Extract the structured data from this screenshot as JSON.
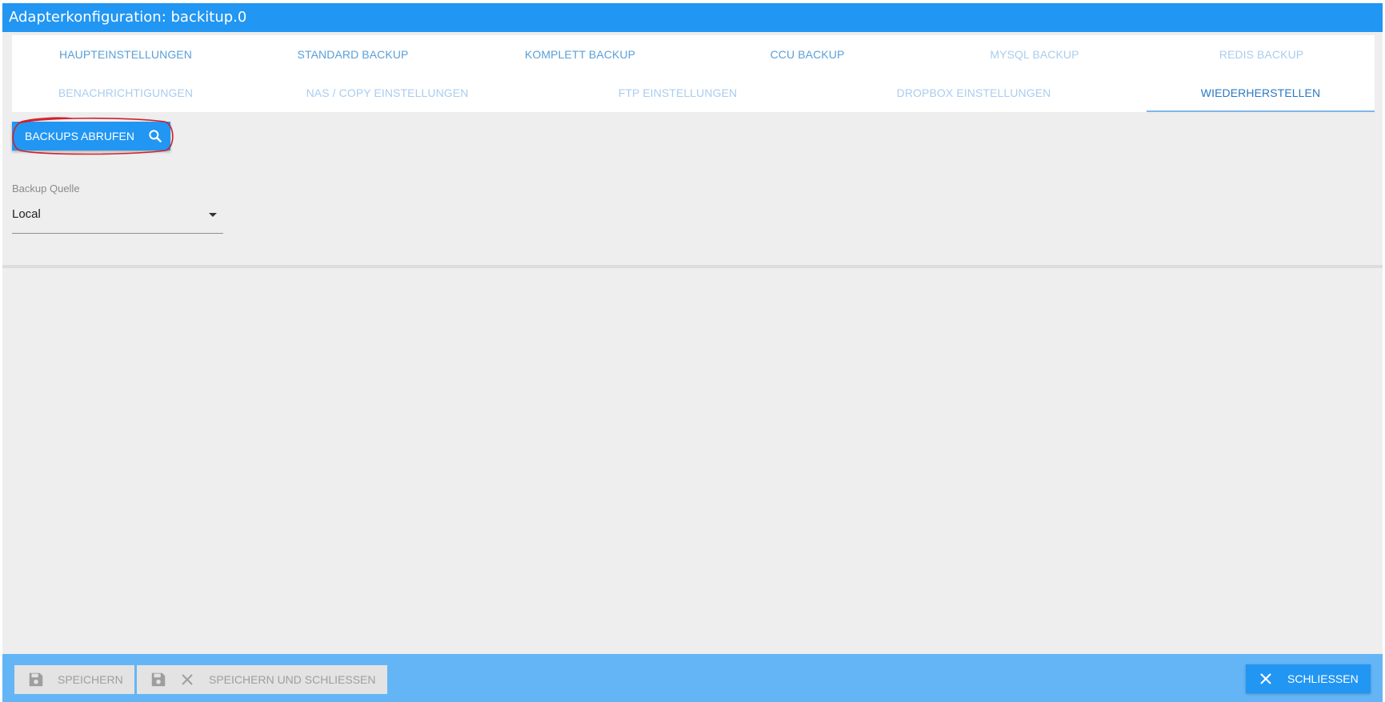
{
  "window": {
    "title": "Adapterkonfiguration: backitup.0"
  },
  "tabs": {
    "row1": [
      {
        "label": "HAUPTEINSTELLUNGEN",
        "state": "enabled"
      },
      {
        "label": "STANDARD BACKUP",
        "state": "enabled"
      },
      {
        "label": "KOMPLETT BACKUP",
        "state": "enabled"
      },
      {
        "label": "CCU BACKUP",
        "state": "enabled"
      },
      {
        "label": "MYSQL BACKUP",
        "state": "disabled"
      },
      {
        "label": "REDIS BACKUP",
        "state": "disabled"
      }
    ],
    "row2": [
      {
        "label": "BENACHRICHTIGUNGEN",
        "state": "disabled"
      },
      {
        "label": "NAS / COPY EINSTELLUNGEN",
        "state": "disabled"
      },
      {
        "label": "FTP EINSTELLUNGEN",
        "state": "disabled"
      },
      {
        "label": "DROPBOX EINSTELLUNGEN",
        "state": "disabled"
      },
      {
        "label": "WIEDERHERSTELLEN",
        "state": "active"
      }
    ]
  },
  "restore": {
    "fetch_button_label": "BACKUPS ABRUFEN",
    "fetch_button_icon": "search-icon",
    "source_label": "Backup Quelle",
    "source_value": "Local"
  },
  "footer": {
    "save_label": "SPEICHERN",
    "save_close_label": "SPEICHERN UND SCHLIESSEN",
    "close_label": "SCHLIESSEN"
  },
  "colors": {
    "primary": "#2196f3",
    "footer_bar": "#64b5f6",
    "annotation": "#d0202a",
    "background": "#eeeeee"
  }
}
